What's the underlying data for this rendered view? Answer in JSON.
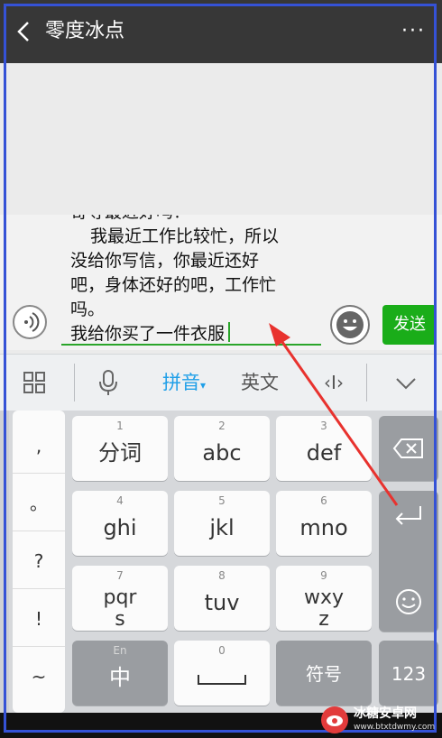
{
  "header": {
    "title": "零度冰点",
    "more_label": "···"
  },
  "composer": {
    "text_lines": [
      "寄等最近好吗？",
      "我最近工作比较忙，所以",
      "没给你写信，你最近还好",
      "吧，身体还好的吧，工作忙",
      "吗。",
      "我给你买了一件衣服"
    ],
    "send_label": "发送"
  },
  "ime_toolbar": {
    "grid_icon": "grid-icon",
    "mic_icon": "mic-icon",
    "pinyin_label": "拼音",
    "english_label": "英文",
    "cursor_label": "‹I›",
    "collapse_icon": "chevron-down-icon",
    "accent_color": "#1f9fe8"
  },
  "keyboard": {
    "punctuation": [
      ",",
      "。",
      "?",
      "!",
      "~"
    ],
    "keys": [
      {
        "num": "1",
        "label": "分词"
      },
      {
        "num": "2",
        "label": "abc"
      },
      {
        "num": "3",
        "label": "def"
      },
      {
        "num": "4",
        "label": "ghi"
      },
      {
        "num": "5",
        "label": "jkl"
      },
      {
        "num": "6",
        "label": "mno"
      },
      {
        "num": "7",
        "label": "pqrs"
      },
      {
        "num": "8",
        "label": "tuv"
      },
      {
        "num": "9",
        "label": "wxyz"
      },
      {
        "num": "En",
        "label": "中"
      },
      {
        "num": "0",
        "label": "space"
      },
      {
        "num": "",
        "label": "符号"
      },
      {
        "num": "",
        "label": "123"
      }
    ]
  },
  "watermark": {
    "title": "冰糖安卓网",
    "url": "www.btxtdwmy.com"
  },
  "colors": {
    "titlebar": "#373737",
    "send_button": "#1aad19",
    "annotation_box": "#3552d6",
    "annotation_arrow": "#e8322e"
  }
}
